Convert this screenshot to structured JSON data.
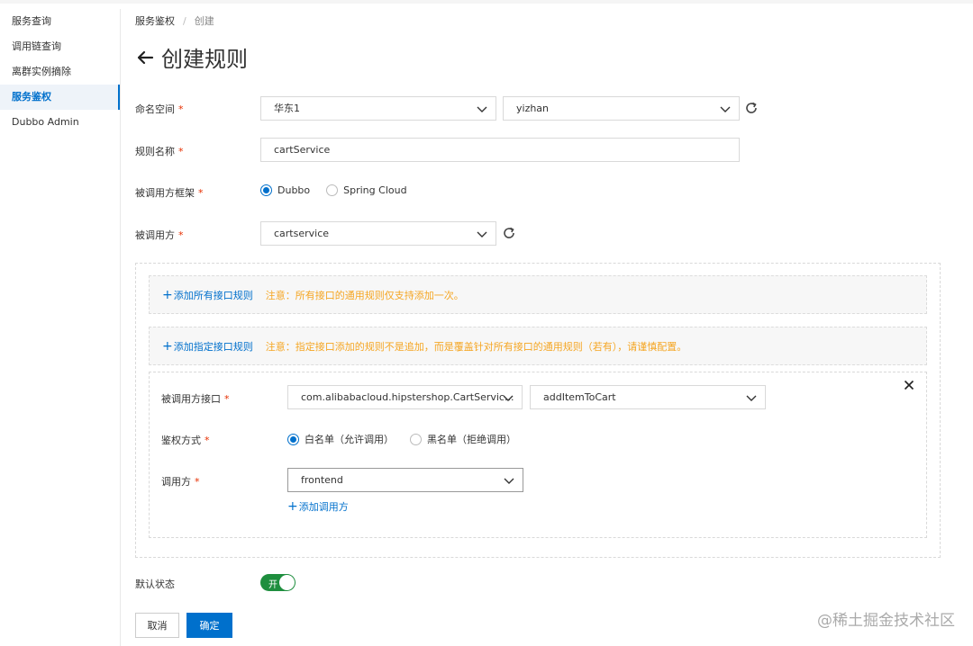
{
  "sidebar": {
    "items": [
      {
        "label": "服务查询"
      },
      {
        "label": "调用链查询"
      },
      {
        "label": "离群实例摘除"
      },
      {
        "label": "服务鉴权"
      },
      {
        "label": "Dubbo Admin"
      }
    ],
    "active_index": 3
  },
  "breadcrumb": {
    "parent": "服务鉴权",
    "separator": "/",
    "current": "创建"
  },
  "page": {
    "title": "创建规则"
  },
  "form": {
    "namespace": {
      "label": "命名空间",
      "required_mark": "*",
      "region": "华东1",
      "namespace": "yizhan"
    },
    "rule_name": {
      "label": "规则名称",
      "required_mark": "*",
      "value": "cartService"
    },
    "framework": {
      "label": "被调用方框架",
      "required_mark": "*",
      "options": [
        "Dubbo",
        "Spring Cloud"
      ],
      "selected": "Dubbo"
    },
    "callee": {
      "label": "被调用方",
      "required_mark": "*",
      "value": "cartservice"
    },
    "all_interfaces": {
      "add_label": "添加所有接口规则",
      "note": "注意：所有接口的通用规则仅支持添加一次。"
    },
    "specific_interfaces": {
      "add_label": "添加指定接口规则",
      "note": "注意：指定接口添加的规则不是追加，而是覆盖针对所有接口的通用规则（若有），请谨慎配置。"
    },
    "interface_rule": {
      "interface_label": "被调用方接口",
      "required_mark": "*",
      "interface_value": "com.alibabacloud.hipstershop.CartServic...",
      "method_value": "addItemToCart",
      "auth_label": "鉴权方式",
      "auth_options": [
        "白名单（允许调用）",
        "黑名单（拒绝调用）"
      ],
      "auth_selected": "白名单（允许调用）",
      "caller_label": "调用方",
      "caller_value": "frontend",
      "add_caller_label": "添加调用方"
    },
    "default_status": {
      "label": "默认状态",
      "toggle_label": "开",
      "on": true
    }
  },
  "actions": {
    "cancel": "取消",
    "confirm": "确定"
  },
  "watermark": "@稀土掘金技术社区",
  "colors": {
    "primary": "#0070cc",
    "warning": "#f5a623",
    "required": "#e62e00",
    "toggle_on": "#1e8e3e"
  },
  "icons": [
    "back-arrow-icon",
    "chevron-down-icon",
    "refresh-icon",
    "plus-icon",
    "close-icon"
  ]
}
